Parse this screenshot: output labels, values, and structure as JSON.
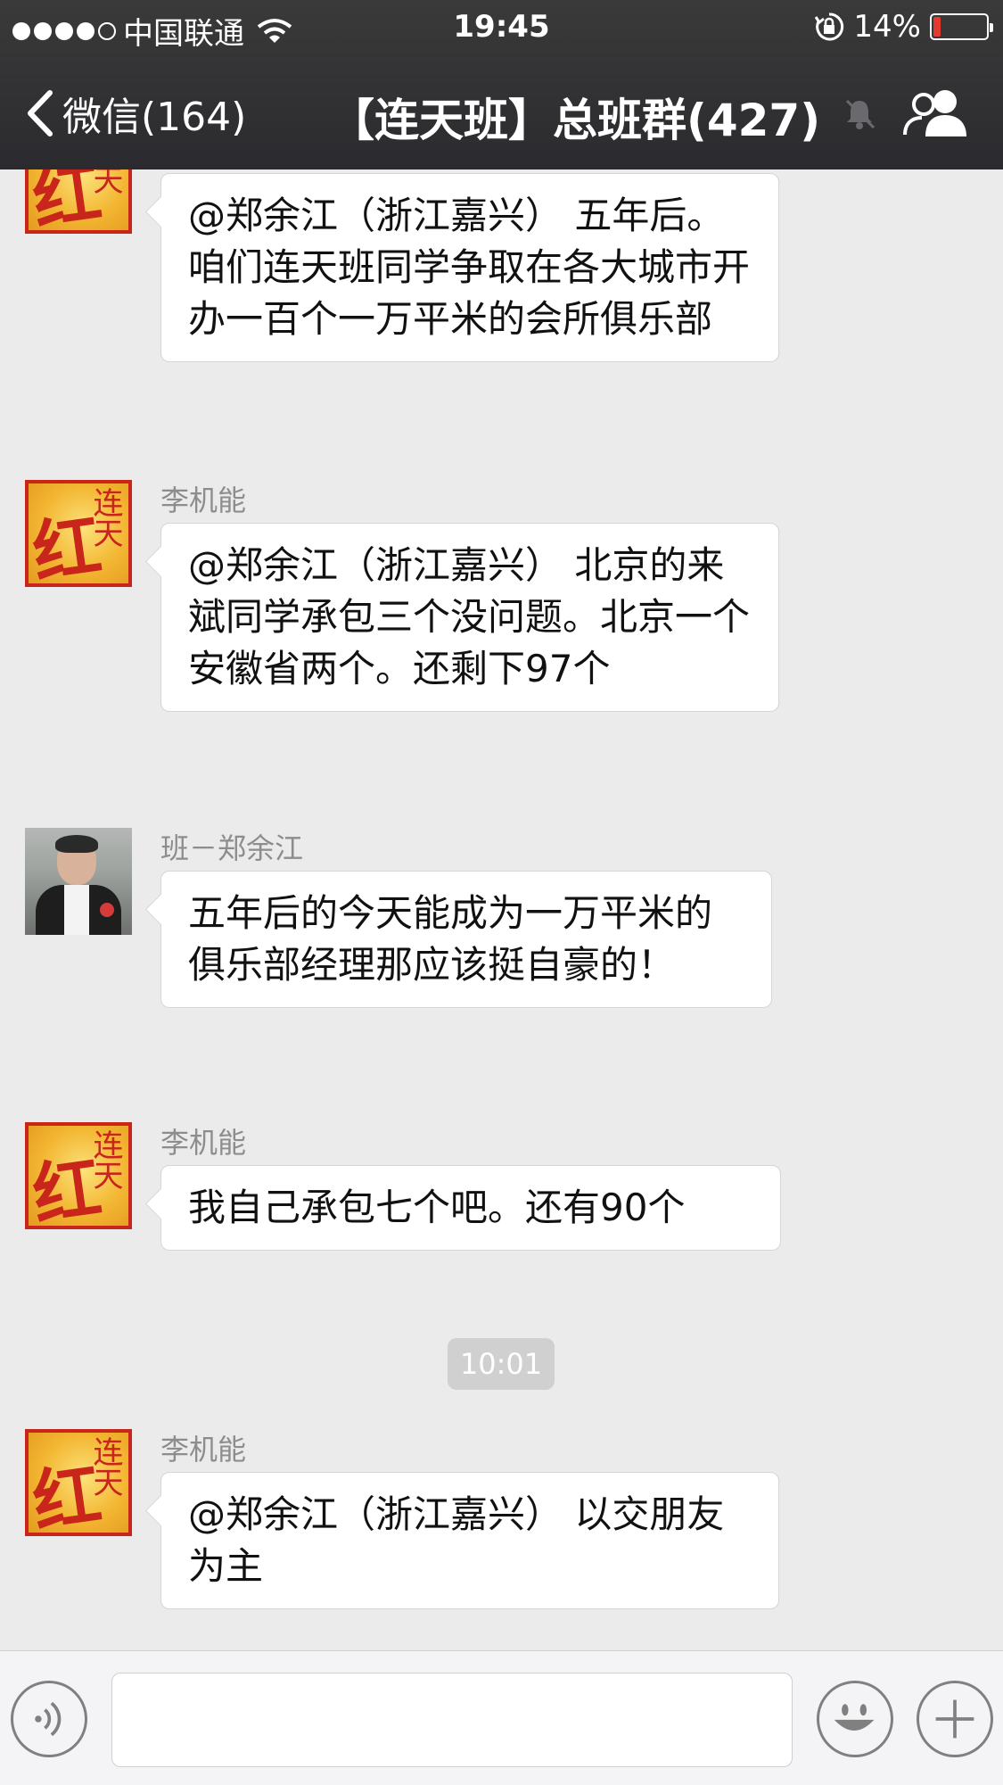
{
  "status_bar": {
    "carrier": "中国联通",
    "time": "19:45",
    "battery": "14%",
    "battery_level": 0.14,
    "signal_dots_filled": 4
  },
  "nav": {
    "back_label": "微信(164)",
    "title": "【连天班】总班群(427)"
  },
  "messages": [
    {
      "sender": "",
      "avatar": "seal-logo",
      "text": "@郑余江（浙江嘉兴） 五年后。咱们连天班同学争取在各大城市开办一百个一万平米的会所俱乐部"
    },
    {
      "sender": "李机能",
      "avatar": "seal-logo",
      "text": "@郑余江（浙江嘉兴） 北京的来斌同学承包三个没问题。北京一个 安徽省两个。还剩下97个"
    },
    {
      "sender": "班－郑余江",
      "avatar": "photo",
      "text": "五年后的今天能成为一万平米的俱乐部经理那应该挺自豪的！"
    },
    {
      "sender": "李机能",
      "avatar": "seal-logo",
      "text": "我自己承包七个吧。还有90个"
    },
    {
      "sender": "李机能",
      "avatar": "seal-logo",
      "text": "@郑余江（浙江嘉兴） 以交朋友为主"
    }
  ],
  "timestamp": "10:01",
  "seal": {
    "main": "红",
    "side": "连天"
  },
  "input": {
    "value": "",
    "placeholder": ""
  },
  "icons": {
    "voice": "voice-icon",
    "emoji": "emoji-icon",
    "plus": "plus-icon",
    "members": "members-icon",
    "mute": "mute-bell-icon"
  },
  "colors": {
    "nav_bg": "#2f2f33",
    "chat_bg": "#ebebeb",
    "bubble_bg": "#ffffff",
    "battery_low": "#e33b2e",
    "seal_red": "#c8261b"
  }
}
